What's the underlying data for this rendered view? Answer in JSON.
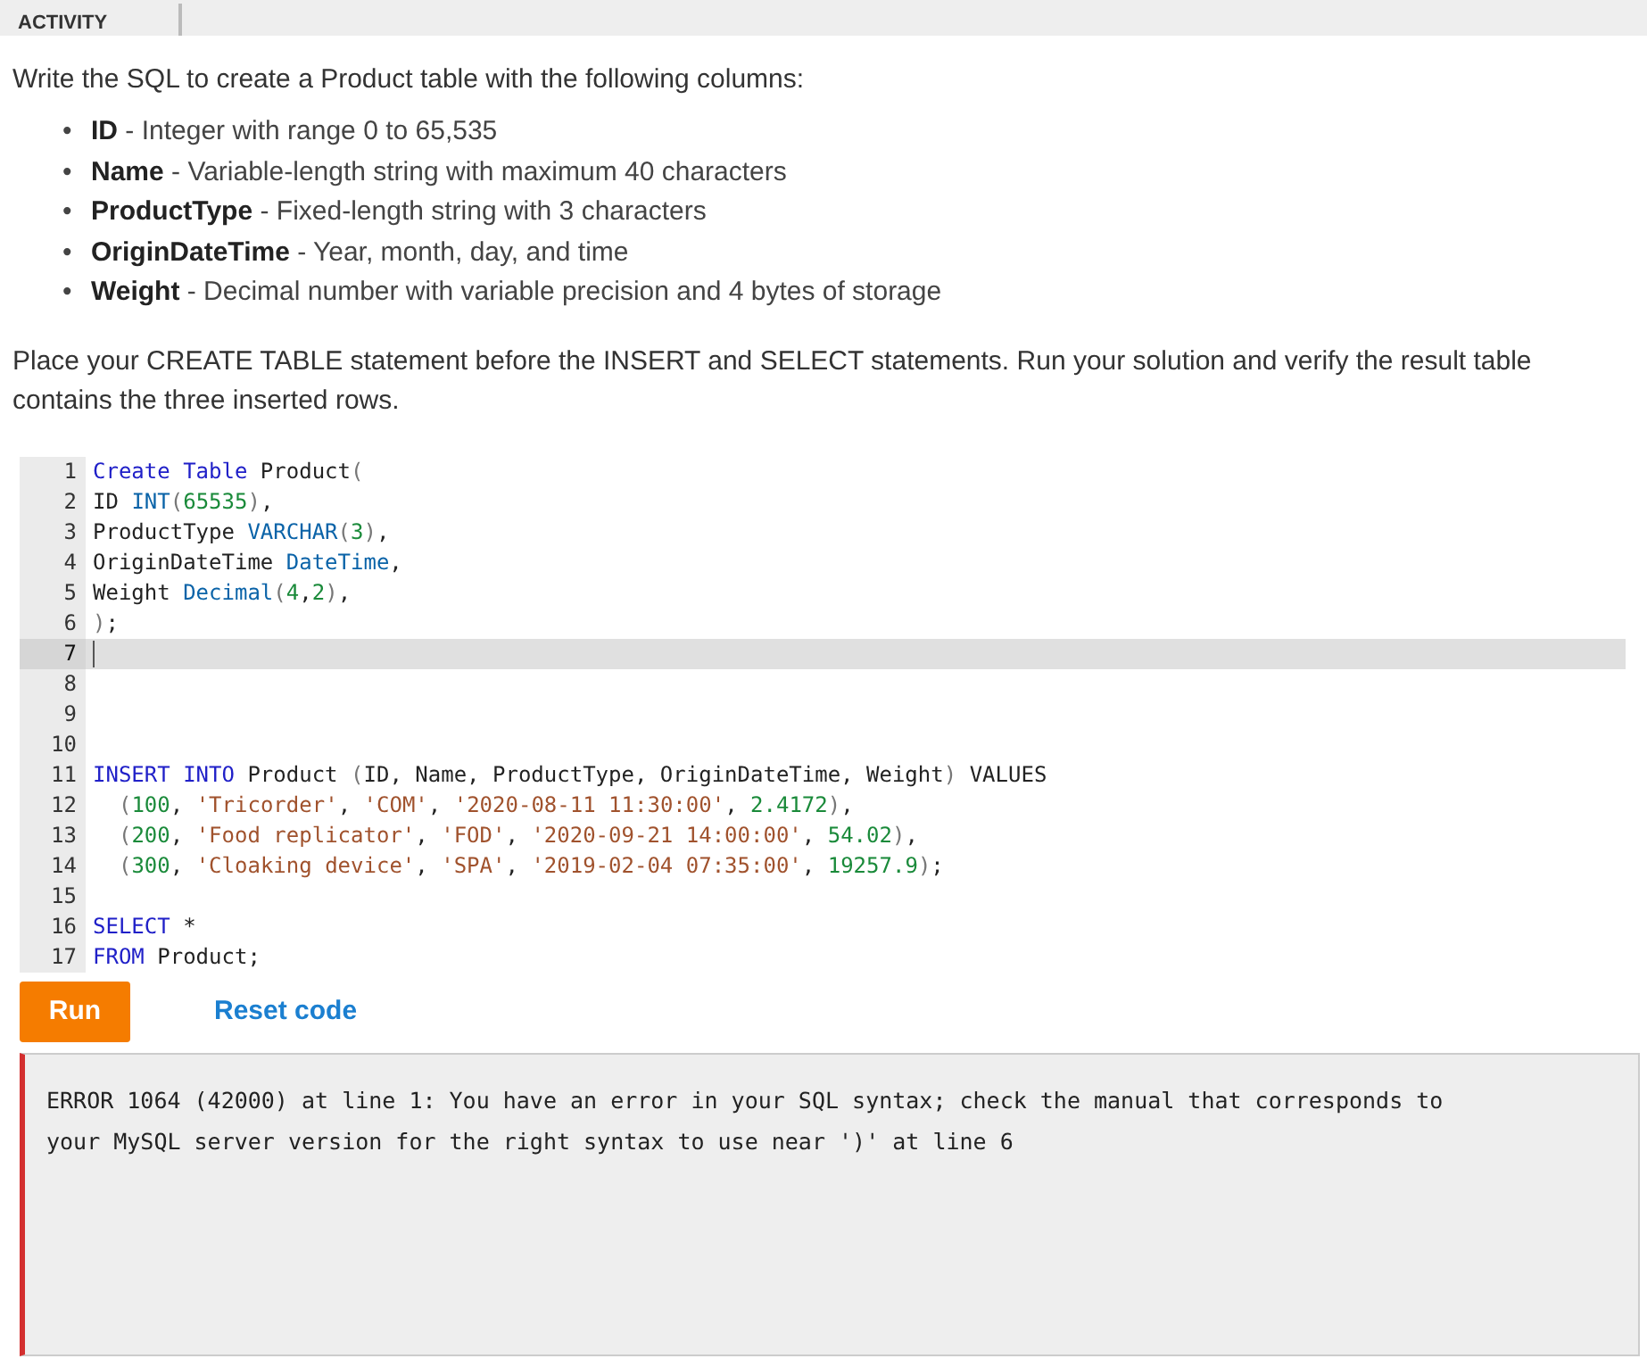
{
  "header": {
    "label": "ACTIVITY"
  },
  "prompt": "Write the SQL to create a Product table with the following columns:",
  "columns": [
    {
      "marker": "•",
      "name": "ID",
      "description": " - Integer with range 0 to 65,535"
    },
    {
      "marker": "•",
      "name": "Name",
      "description": " - Variable-length string with maximum 40 characters"
    },
    {
      "marker": "•",
      "name": "ProductType",
      "description": " - Fixed-length string with 3 characters"
    },
    {
      "marker": "•",
      "name": "OriginDateTime",
      "description": " - Year, month, day, and time"
    },
    {
      "marker": "•",
      "name": "Weight",
      "description": " - Decimal number with variable precision and 4 bytes of storage"
    }
  ],
  "instructions": "Place your CREATE TABLE statement before the INSERT and SELECT statements. Run your solution and verify the result table contains the three inserted rows.",
  "editor": {
    "lines": [
      {
        "number": "1",
        "active": false,
        "tokens": [
          {
            "kind": "keyword",
            "text": "Create Table"
          },
          {
            "kind": "plain",
            "text": " Product"
          },
          {
            "kind": "bracket",
            "text": "("
          }
        ]
      },
      {
        "number": "2",
        "active": false,
        "tokens": [
          {
            "kind": "plain",
            "text": "ID "
          },
          {
            "kind": "type",
            "text": "INT"
          },
          {
            "kind": "bracket",
            "text": "("
          },
          {
            "kind": "number",
            "text": "65535"
          },
          {
            "kind": "bracket",
            "text": ")"
          },
          {
            "kind": "plain",
            "text": ","
          }
        ]
      },
      {
        "number": "3",
        "active": false,
        "tokens": [
          {
            "kind": "plain",
            "text": "ProductType "
          },
          {
            "kind": "type",
            "text": "VARCHAR"
          },
          {
            "kind": "bracket",
            "text": "("
          },
          {
            "kind": "number",
            "text": "3"
          },
          {
            "kind": "bracket",
            "text": ")"
          },
          {
            "kind": "plain",
            "text": ","
          }
        ]
      },
      {
        "number": "4",
        "active": false,
        "tokens": [
          {
            "kind": "plain",
            "text": "OriginDateTime "
          },
          {
            "kind": "type",
            "text": "DateTime"
          },
          {
            "kind": "plain",
            "text": ","
          }
        ]
      },
      {
        "number": "5",
        "active": false,
        "tokens": [
          {
            "kind": "plain",
            "text": "Weight "
          },
          {
            "kind": "type",
            "text": "Decimal"
          },
          {
            "kind": "bracket",
            "text": "("
          },
          {
            "kind": "number",
            "text": "4"
          },
          {
            "kind": "plain",
            "text": ","
          },
          {
            "kind": "number",
            "text": "2"
          },
          {
            "kind": "bracket",
            "text": ")"
          },
          {
            "kind": "plain",
            "text": ","
          }
        ]
      },
      {
        "number": "6",
        "active": false,
        "tokens": [
          {
            "kind": "bracket",
            "text": ")"
          },
          {
            "kind": "plain",
            "text": ";"
          }
        ]
      },
      {
        "number": "7",
        "active": true
      },
      {
        "number": "8",
        "active": false
      },
      {
        "number": "9",
        "active": false
      },
      {
        "number": "10",
        "active": false
      },
      {
        "number": "11",
        "active": false,
        "tokens": [
          {
            "kind": "keyword",
            "text": "INSERT INTO"
          },
          {
            "kind": "plain",
            "text": " Product "
          },
          {
            "kind": "bracket",
            "text": "("
          },
          {
            "kind": "plain",
            "text": "ID, Name, ProductType, OriginDateTime, Weight"
          },
          {
            "kind": "bracket",
            "text": ")"
          },
          {
            "kind": "plain",
            "text": " VALUES"
          }
        ]
      },
      {
        "number": "12",
        "active": false,
        "tokens": [
          {
            "kind": "bracket",
            "text": "  ("
          },
          {
            "kind": "number",
            "text": "100"
          },
          {
            "kind": "plain",
            "text": ", "
          },
          {
            "kind": "string",
            "text": "'Tricorder'"
          },
          {
            "kind": "plain",
            "text": ", "
          },
          {
            "kind": "string",
            "text": "'COM'"
          },
          {
            "kind": "plain",
            "text": ", "
          },
          {
            "kind": "string",
            "text": "'2020-08-11 11:30:00'"
          },
          {
            "kind": "plain",
            "text": ", "
          },
          {
            "kind": "number",
            "text": "2.4172"
          },
          {
            "kind": "bracket",
            "text": ")"
          },
          {
            "kind": "plain",
            "text": ","
          }
        ]
      },
      {
        "number": "13",
        "active": false,
        "tokens": [
          {
            "kind": "bracket",
            "text": "  ("
          },
          {
            "kind": "number",
            "text": "200"
          },
          {
            "kind": "plain",
            "text": ", "
          },
          {
            "kind": "string",
            "text": "'Food replicator'"
          },
          {
            "kind": "plain",
            "text": ", "
          },
          {
            "kind": "string",
            "text": "'FOD'"
          },
          {
            "kind": "plain",
            "text": ", "
          },
          {
            "kind": "string",
            "text": "'2020-09-21 14:00:00'"
          },
          {
            "kind": "plain",
            "text": ", "
          },
          {
            "kind": "number",
            "text": "54.02"
          },
          {
            "kind": "bracket",
            "text": ")"
          },
          {
            "kind": "plain",
            "text": ","
          }
        ]
      },
      {
        "number": "14",
        "active": false,
        "tokens": [
          {
            "kind": "bracket",
            "text": "  ("
          },
          {
            "kind": "number",
            "text": "300"
          },
          {
            "kind": "plain",
            "text": ", "
          },
          {
            "kind": "string",
            "text": "'Cloaking device'"
          },
          {
            "kind": "plain",
            "text": ", "
          },
          {
            "kind": "string",
            "text": "'SPA'"
          },
          {
            "kind": "plain",
            "text": ", "
          },
          {
            "kind": "string",
            "text": "'2019-02-04 07:35:00'"
          },
          {
            "kind": "plain",
            "text": ", "
          },
          {
            "kind": "number",
            "text": "19257.9"
          },
          {
            "kind": "bracket",
            "text": ")"
          },
          {
            "kind": "plain",
            "text": ";"
          }
        ]
      },
      {
        "number": "15",
        "active": false
      },
      {
        "number": "16",
        "active": false,
        "tokens": [
          {
            "kind": "keyword",
            "text": "SELECT"
          },
          {
            "kind": "plain",
            "text": " *"
          }
        ]
      },
      {
        "number": "17",
        "active": false,
        "tokens": [
          {
            "kind": "keyword",
            "text": "FROM"
          },
          {
            "kind": "plain",
            "text": " Product;"
          }
        ]
      }
    ]
  },
  "buttons": {
    "run": "Run",
    "reset": "Reset code"
  },
  "output": {
    "text": "ERROR 1064 (42000) at line 1: You have an error in your SQL syntax; check the manual that corresponds to your MySQL server version for the right syntax to use near ')' at line 6"
  }
}
